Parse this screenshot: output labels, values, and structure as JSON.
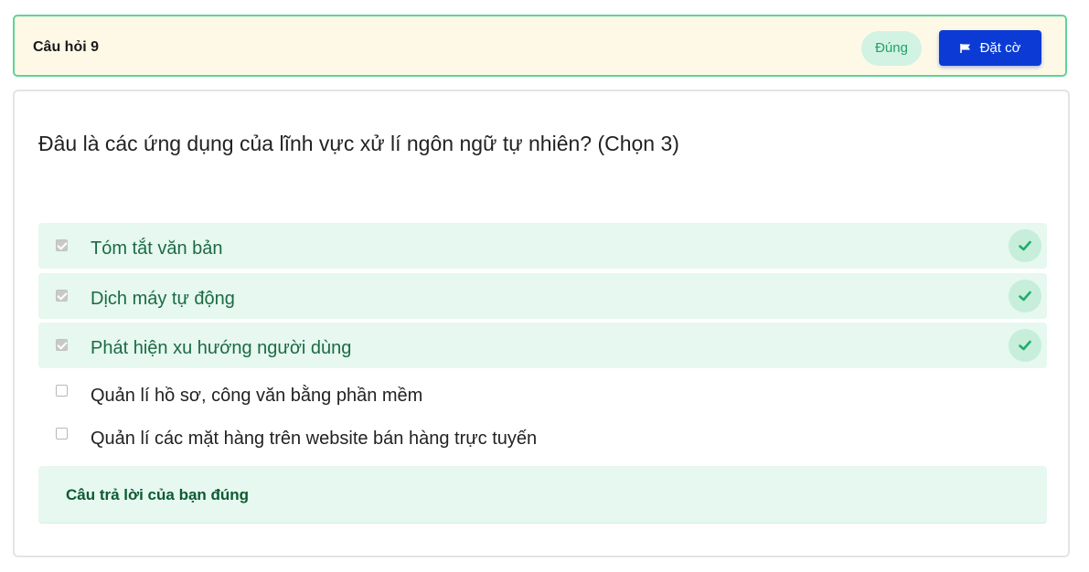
{
  "header": {
    "title": "Câu hỏi 9",
    "status": "Đúng",
    "flag_label": "Đặt cờ",
    "flag_icon": "flag-icon"
  },
  "question": {
    "text": "Đâu là các ứng dụng của lĩnh vực xử lí ngôn ngữ tự nhiên? (Chọn 3)",
    "options": [
      {
        "label": "Tóm tắt văn bản",
        "checked": true,
        "correct": true
      },
      {
        "label": "Dịch máy tự động",
        "checked": true,
        "correct": true
      },
      {
        "label": "Phát hiện xu hướng người dùng",
        "checked": true,
        "correct": true
      },
      {
        "label": "Quản lí hồ sơ, công văn bằng phần mềm",
        "checked": false,
        "correct": false
      },
      {
        "label": "Quản lí các mặt hàng trên website bán hàng trực tuyến",
        "checked": false,
        "correct": false
      }
    ]
  },
  "feedback": {
    "text": "Câu trả lời của bạn đúng"
  },
  "colors": {
    "accent": "#0b3bd4",
    "correct_bg": "#e6f8ef",
    "correct_text": "#1c6a45",
    "header_bg": "#fef9e7",
    "header_border": "#5fd39a"
  }
}
